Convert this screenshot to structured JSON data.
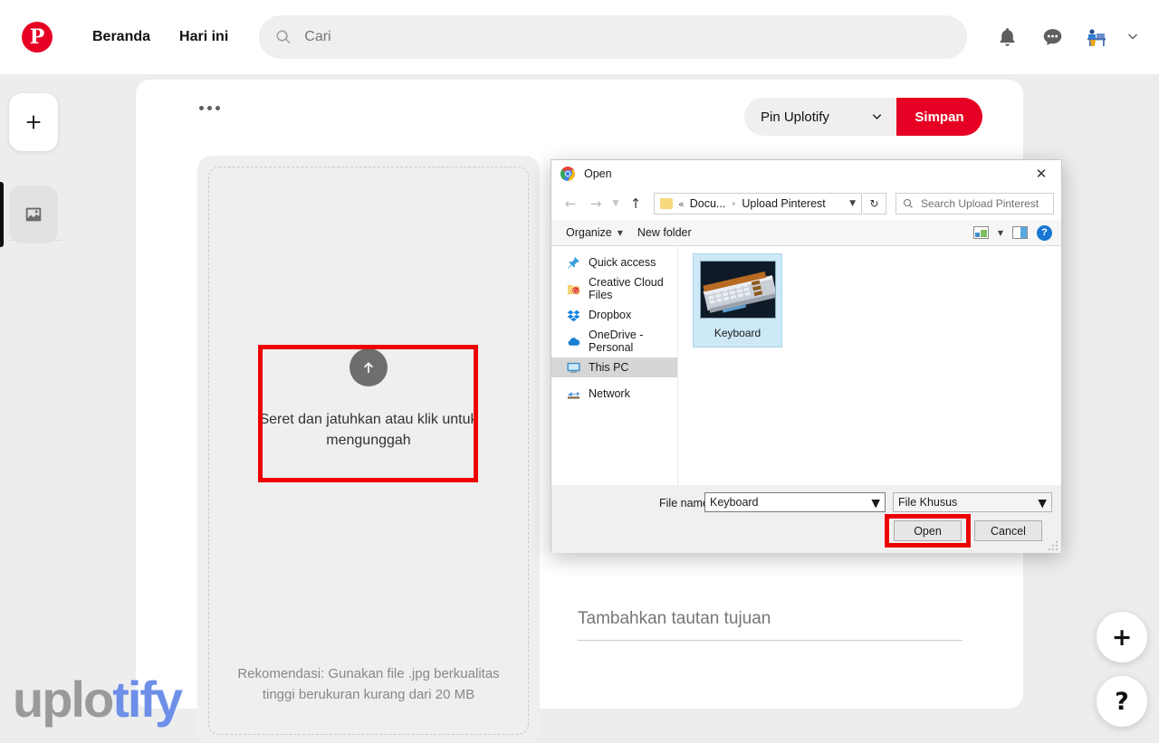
{
  "header": {
    "logo_icon": "pinterest-logo-icon",
    "logo_letter": "P",
    "nav": [
      {
        "label": "Beranda"
      },
      {
        "label": "Hari ini"
      }
    ],
    "search": {
      "icon": "search-icon",
      "placeholder": "Cari",
      "value": ""
    },
    "icons": [
      {
        "name": "notifications-bell-icon"
      },
      {
        "name": "messages-chat-icon"
      },
      {
        "name": "user-avatar"
      },
      {
        "name": "chevron-down-icon"
      }
    ]
  },
  "left_rail": {
    "add_icon": "plus-icon",
    "library_icon": "image-icon"
  },
  "main": {
    "more_options_icon": "more-options-icon",
    "board_select": {
      "label": "Pin Uplotify",
      "caret_icon": "chevron-down-icon"
    },
    "save_label": "Simpan",
    "upload": {
      "arrow_icon": "upload-arrow-icon",
      "drop_text": "Seret dan jatuhkan atau klik untuk mengunggah",
      "recommendation": "Rekomendasi: Gunakan file .jpg berkualitas tinggi berukuran kurang dari 20 MB"
    },
    "destination": {
      "placeholder": "Tambahkan tautan tujuan",
      "value": ""
    }
  },
  "dialog": {
    "app_icon": "chrome-icon",
    "title": "Open",
    "close_icon": "close-icon",
    "nav": {
      "back_icon": "arrow-left-icon",
      "forward_icon": "arrow-right-icon",
      "history_icon": "chevron-down-icon",
      "up_icon": "arrow-up-icon",
      "refresh_icon": "refresh-icon"
    },
    "breadcrumb": {
      "folder_icon": "folder-icon",
      "overflow": "«",
      "parent": "Docu...",
      "separator": "›",
      "current": "Upload Pinterest",
      "dropdown_icon": "chevron-down-icon"
    },
    "search": {
      "icon": "search-icon",
      "placeholder": "Search Upload Pinterest",
      "value": ""
    },
    "toolbar": {
      "organize_label": "Organize",
      "organize_caret_icon": "chevron-down-icon",
      "new_folder_label": "New folder",
      "view_icon": "view-layout-icon",
      "view_caret_icon": "chevron-down-icon",
      "preview_pane_icon": "preview-pane-icon",
      "help_icon": "help-icon",
      "help_glyph": "?"
    },
    "sidebar_items": [
      {
        "label": "Quick access",
        "icon": "pin-star-icon",
        "selected": false
      },
      {
        "label": "Creative Cloud Files",
        "icon": "creative-cloud-icon",
        "selected": false
      },
      {
        "label": "Dropbox",
        "icon": "dropbox-icon",
        "selected": false
      },
      {
        "label": "OneDrive - Personal",
        "icon": "onedrive-cloud-icon",
        "selected": false
      },
      {
        "label": "This PC",
        "icon": "this-pc-icon",
        "selected": true
      },
      {
        "label": "Network",
        "icon": "network-icon",
        "selected": false
      }
    ],
    "files": [
      {
        "name": "Keyboard",
        "thumb": "keyboard-photo",
        "selected": true
      }
    ],
    "footer": {
      "file_name_label": "File name:",
      "file_name_value": "Keyboard",
      "file_name_caret_icon": "chevron-down-icon",
      "file_type_value": "File Khusus",
      "file_type_caret_icon": "chevron-down-icon",
      "open_label": "Open",
      "cancel_label": "Cancel",
      "resize_grip_icon": "resize-grip-icon"
    }
  },
  "fabs": [
    {
      "name": "add-fab",
      "glyph": "+"
    },
    {
      "name": "help-fab",
      "glyph": "?"
    }
  ],
  "watermark": {
    "part1": "uplo",
    "part2": "tify"
  },
  "colors": {
    "brand_red": "#e60023",
    "highlight_red": "#ee0000",
    "accent_blue": "#1876d2",
    "selection_blue": "#cde8f7"
  }
}
